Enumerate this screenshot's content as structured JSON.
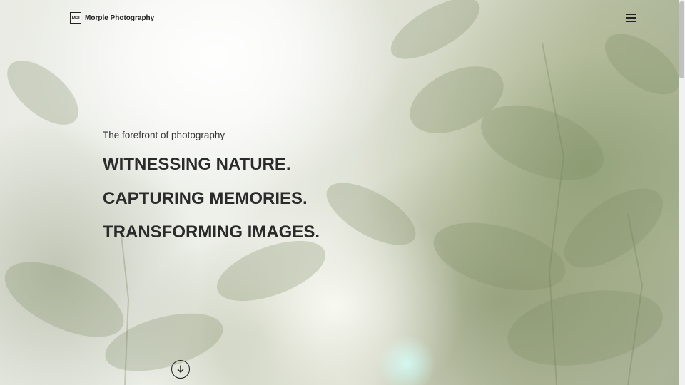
{
  "brand": {
    "logo_text": "MPI",
    "name": "Morple Photography"
  },
  "icons": {
    "menu": "hamburger-menu-icon",
    "scroll": "arrow-down-circle-icon"
  },
  "hero": {
    "tagline": "The forefront of photography",
    "headlines": [
      "WITNESSING NATURE.",
      "CAPTURING MEMORIES.",
      "TRANSFORMING IMAGES."
    ]
  },
  "colors": {
    "text": "#2b2b2b",
    "scrollbar_track": "#f1f1f1",
    "scrollbar_thumb": "#c1c1c1"
  }
}
